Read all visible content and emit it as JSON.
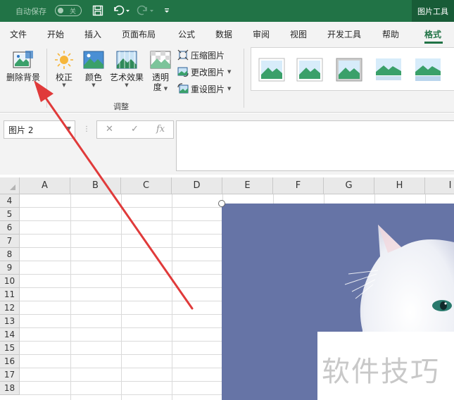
{
  "title_bar": {
    "autosave_label": "自动保存",
    "autosave_state": "关",
    "context_tab": "图片工具"
  },
  "tabs": [
    "文件",
    "开始",
    "插入",
    "页面布局",
    "公式",
    "数据",
    "审阅",
    "视图",
    "开发工具",
    "帮助",
    "格式"
  ],
  "active_tab": "格式",
  "ribbon": {
    "remove_background": "删除背景",
    "corrections": "校正",
    "color": "颜色",
    "artistic_effects": "艺术效果",
    "transparency_line1": "透明",
    "transparency_line2": "度",
    "compress_pictures": "压缩图片",
    "change_picture": "更改图片",
    "reset_picture": "重设图片",
    "adjust_group": "调整"
  },
  "formula_bar": {
    "name_box": "图片 2",
    "fx": "fx",
    "cancel": "✕",
    "enter": "✓",
    "dots": "⋮"
  },
  "sheet": {
    "columns": [
      "A",
      "B",
      "C",
      "D",
      "E",
      "F",
      "G",
      "H",
      "I"
    ],
    "rows": [
      "4",
      "5",
      "6",
      "7",
      "8",
      "9",
      "10",
      "11",
      "12",
      "13",
      "14",
      "15",
      "16",
      "17",
      "18"
    ]
  },
  "watermark": "软件技巧",
  "colors": {
    "excel_green": "#217346",
    "picture_background": "#6674a6",
    "arrow": "#e03a3a"
  }
}
